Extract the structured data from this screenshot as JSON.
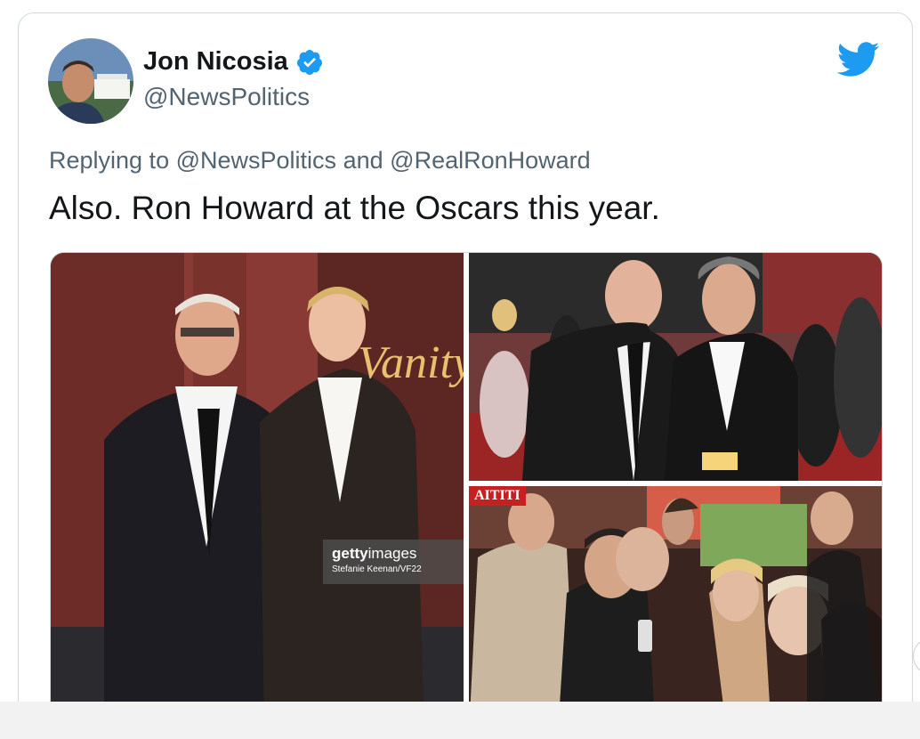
{
  "tweet": {
    "author_name": "Jon Nicosia",
    "author_handle": "@NewsPolitics",
    "reply_prefix": "Replying to",
    "reply_mention_1": "@NewsPolitics",
    "reply_and": "and",
    "reply_mention_2": "@RealRonHoward",
    "text": "Also. Ron Howard at the Oscars this year.",
    "verified": true
  },
  "media": {
    "watermark_brand": "getty",
    "watermark_brand_suffix": "images",
    "watermark_credit": "Stefanie Keenan/VF22",
    "sign_text": "Vanity",
    "banner_text": "AITITI"
  },
  "colors": {
    "twitter_blue": "#1d9bf0",
    "text_primary": "#14171a",
    "text_secondary": "#536471"
  },
  "icons": {
    "verified": "verified-badge-icon",
    "logo": "twitter-bird-icon"
  }
}
